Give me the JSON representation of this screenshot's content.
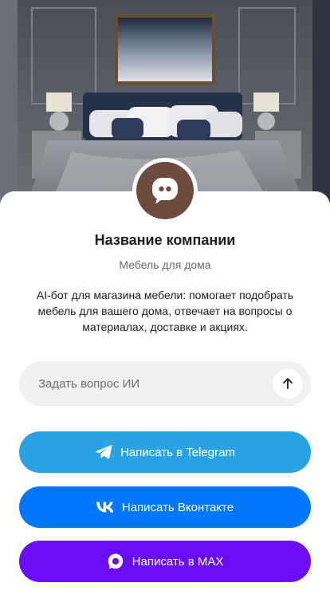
{
  "company": {
    "name": "Название компании",
    "category": "Мебель для дома",
    "description": "AI-бот для магазина мебели: помогает подобрать мебель для вашего дома, отвечает на вопросы о материалах, доставке и акциях."
  },
  "ask": {
    "placeholder": "Задать вопрос ИИ"
  },
  "buttons": {
    "telegram": "Написать в Telegram",
    "vk": "Написать Вконтакте",
    "max": "Написать в MAX"
  },
  "colors": {
    "avatar": "#6d4b3f",
    "telegram": "#2aa3e3",
    "vk": "#0077ff",
    "max": "#6a0cf5"
  },
  "icons": {
    "avatar": "chat-bot-icon",
    "send": "arrow-up-icon",
    "telegram": "telegram-icon",
    "vk": "vk-icon",
    "max": "max-icon"
  }
}
